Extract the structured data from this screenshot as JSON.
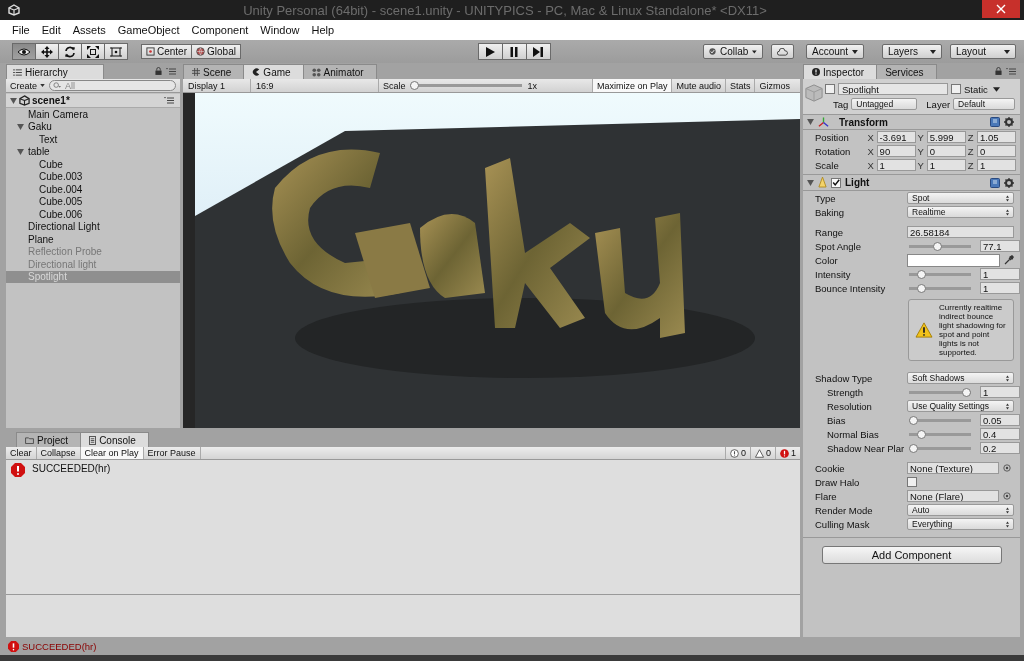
{
  "window": {
    "title": "Unity Personal (64bit) - scene1.unity - UNITYPICS - PC, Mac & Linux Standalone* <DX11>"
  },
  "menu": [
    "File",
    "Edit",
    "Assets",
    "GameObject",
    "Component",
    "Window",
    "Help"
  ],
  "tools": [
    {
      "kind": "view",
      "selected": true
    },
    {
      "kind": "move",
      "selected": false
    },
    {
      "kind": "rotate",
      "selected": false
    },
    {
      "kind": "scale",
      "selected": false
    },
    {
      "kind": "rect",
      "selected": false
    }
  ],
  "pivot": [
    {
      "kind": "center",
      "label": "Center"
    },
    {
      "kind": "global",
      "label": "Global"
    }
  ],
  "playback": [
    {
      "kind": "play"
    },
    {
      "kind": "pause"
    },
    {
      "kind": "step"
    }
  ],
  "collab": "Collab",
  "account": "Account",
  "layers": "Layers",
  "layout": "Layout",
  "hierarchy": {
    "tab": "Hierarchy",
    "create": "Create",
    "placeholder": "All",
    "scene": "scene1*",
    "items": [
      {
        "name": "Main Camera",
        "active": true,
        "selected": false
      },
      {
        "name": "Gaku",
        "active": true,
        "selected": false,
        "expanded": true,
        "children": [
          {
            "name": "Text",
            "active": true,
            "selected": false
          }
        ]
      },
      {
        "name": "table",
        "active": true,
        "selected": false,
        "expanded": true,
        "children": [
          {
            "name": "Cube",
            "active": true,
            "selected": false
          },
          {
            "name": "Cube.003",
            "active": true,
            "selected": false
          },
          {
            "name": "Cube.004",
            "active": true,
            "selected": false
          },
          {
            "name": "Cube.005",
            "active": true,
            "selected": false
          },
          {
            "name": "Cube.006",
            "active": true,
            "selected": false
          }
        ]
      },
      {
        "name": "Directional Light",
        "active": true,
        "selected": false
      },
      {
        "name": "Plane",
        "active": true,
        "selected": false
      },
      {
        "name": "Reflection Probe",
        "active": false,
        "selected": false
      },
      {
        "name": "Directional light",
        "active": false,
        "selected": false
      },
      {
        "name": "Spotlight",
        "active": false,
        "selected": true
      }
    ]
  },
  "view_tabs": [
    {
      "kind": "scene",
      "label": "Scene",
      "selected": false
    },
    {
      "kind": "game",
      "label": "Game",
      "selected": true
    },
    {
      "kind": "animator",
      "label": "Animator",
      "selected": false
    }
  ],
  "game_bar": {
    "display": "Display 1",
    "aspect": "16:9",
    "scale_label": "Scale",
    "scale": {
      "level": 0
    },
    "scale_reading": "1x",
    "toggles": [
      {
        "label": "Maximize on Play",
        "on": true
      },
      {
        "label": "Mute audio",
        "on": false
      },
      {
        "label": "Stats",
        "on": false
      }
    ],
    "gizmos": "Gizmos"
  },
  "inspector": {
    "tabs": [
      {
        "label": "Inspector",
        "selected": true
      },
      {
        "label": "Services",
        "selected": false
      }
    ],
    "object": {
      "active": false,
      "name": "Spotlight",
      "static_label": "Static",
      "static": false,
      "tag_label": "Tag",
      "tag": "Untagged",
      "layer_label": "Layer",
      "layer": "Default"
    },
    "transform": {
      "title": "Transform",
      "rows": [
        {
          "label": "Position",
          "fields": [
            {
              "axis": "X",
              "value": "-3.691"
            },
            {
              "axis": "Y",
              "value": "5.999"
            },
            {
              "axis": "Z",
              "value": "1.05"
            }
          ]
        },
        {
          "label": "Rotation",
          "fields": [
            {
              "axis": "X",
              "value": "90"
            },
            {
              "axis": "Y",
              "value": "0"
            },
            {
              "axis": "Z",
              "value": "0"
            }
          ]
        },
        {
          "label": "Scale",
          "fields": [
            {
              "axis": "X",
              "value": "1"
            },
            {
              "axis": "Y",
              "value": "1"
            },
            {
              "axis": "Z",
              "value": "1"
            }
          ]
        }
      ]
    },
    "light": {
      "title": "Light",
      "enabled": true,
      "properties": [
        {
          "kind": "dropdown",
          "label": "Type",
          "value": "Spot"
        },
        {
          "kind": "dropdown",
          "label": "Baking",
          "value": "Realtime"
        },
        {
          "kind": "field",
          "label": "Range",
          "value": "26.58184"
        },
        {
          "kind": "slider",
          "label": "Spot Angle",
          "level": 0.45,
          "value": "77.1"
        },
        {
          "kind": "color",
          "label": "Color",
          "color": "#ffffff"
        },
        {
          "kind": "slider",
          "label": "Intensity",
          "level": 0.15,
          "value": "1"
        },
        {
          "kind": "slider",
          "label": "Bounce Intensity",
          "level": 0.15,
          "value": "1"
        },
        {
          "kind": "note",
          "text": "Currently realtime indirect bounce light shadowing for spot and point lights is not supported."
        },
        {
          "kind": "dropdown",
          "label": "Shadow Type",
          "value": "Soft Shadows",
          "children": [
            {
              "kind": "slider",
              "label": "Strength",
              "level": 1,
              "value": "1"
            },
            {
              "kind": "dropdown",
              "label": "Resolution",
              "value": "Use Quality Settings"
            },
            {
              "kind": "slider",
              "label": "Bias",
              "level": 0,
              "value": "0.05"
            },
            {
              "kind": "slider",
              "label": "Normal Bias",
              "level": 0.15,
              "value": "0.4"
            },
            {
              "kind": "slider",
              "label": "Shadow Near Plar",
              "level": 0,
              "value": "0.2"
            }
          ]
        },
        {
          "kind": "object",
          "label": "Cookie",
          "value": "None (Texture)"
        },
        {
          "kind": "checkbox",
          "label": "Draw Halo",
          "checked": false
        },
        {
          "kind": "object",
          "label": "Flare",
          "value": "None (Flare)"
        },
        {
          "kind": "dropdown",
          "label": "Render Mode",
          "value": "Auto"
        },
        {
          "kind": "dropdown",
          "label": "Culling Mask",
          "value": "Everything"
        }
      ]
    },
    "add_component": "Add Component"
  },
  "console": {
    "tabs": [
      {
        "kind": "project",
        "label": "Project",
        "selected": false
      },
      {
        "kind": "console",
        "label": "Console",
        "selected": true
      }
    ],
    "buttons": [
      {
        "label": "Clear",
        "on": false
      },
      {
        "label": "Collapse",
        "on": false
      },
      {
        "label": "Clear on Play",
        "on": true
      },
      {
        "label": "Error Pause",
        "on": false
      }
    ],
    "counts": [
      {
        "kind": "info",
        "count": "0"
      },
      {
        "kind": "warning",
        "count": "0"
      },
      {
        "kind": "error",
        "count": "1"
      }
    ],
    "messages": [
      {
        "kind": "error",
        "text": "SUCCEEDED(hr)"
      }
    ]
  },
  "status_bar": {
    "kind": "error",
    "text": "SUCCEEDED(hr)"
  }
}
